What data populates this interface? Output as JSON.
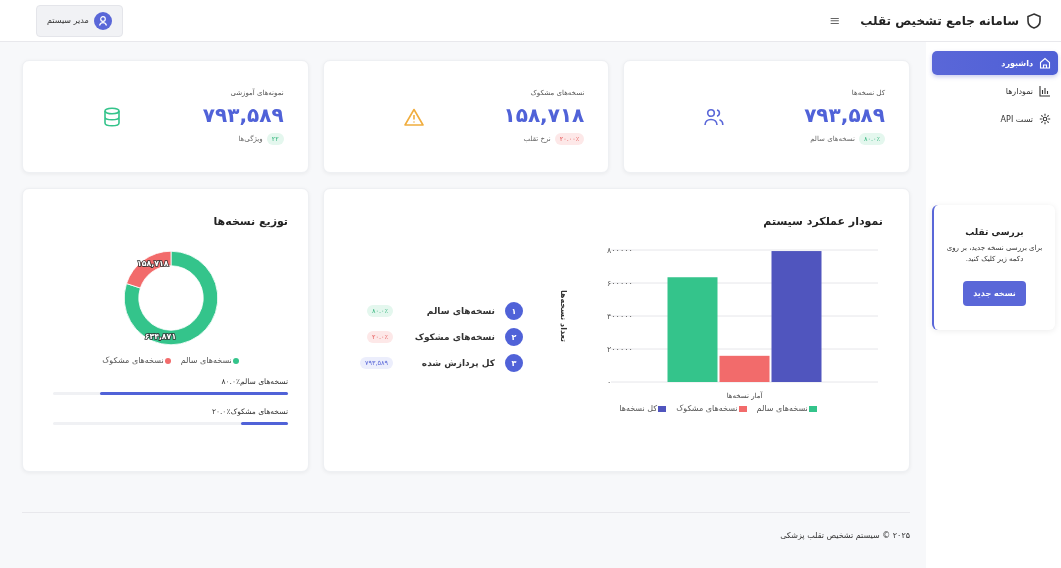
{
  "header": {
    "title": "سامانه جامع تشخیص تقلب",
    "menu_icon": "≡",
    "user": "مدیر سیستم"
  },
  "sidebar": {
    "items": [
      {
        "label": "داشبورد",
        "selected": true
      },
      {
        "label": "نمودارها",
        "selected": false
      },
      {
        "label": "تست API",
        "selected": false
      }
    ],
    "card": {
      "title": "بررسی تقلب",
      "text": "برای بررسی نسخه جدید، بر روی دکمه زیر کلیک کنید.",
      "button": "نسخه جدید"
    }
  },
  "stats": [
    {
      "kind": "users",
      "label": "کل نسخه‌ها",
      "value": "۷۹۳,۵۸۹",
      "badge": "۸۰.۰٪",
      "note": "نسخه‌های سالم"
    },
    {
      "kind": "warning",
      "label": "نسخه‌های مشکوک",
      "value": "۱۵۸,۷۱۸",
      "badge": "۲۰.۰۰٪",
      "note": "نرخ تقلب"
    },
    {
      "kind": "database",
      "label": "نمونه‌های آموزشی",
      "value": "۷۹۳,۵۸۹",
      "badge": "۲۲",
      "note": "ویژگی‌ها"
    }
  ],
  "performance": {
    "title": "نمودار عملکرد سیستم",
    "chart_data": {
      "type": "bar",
      "grid": true,
      "ylabel": "تعداد نسخه‌ها",
      "categories": [
        "آمار نسخه‌ها"
      ],
      "ylim": [
        0,
        800000
      ],
      "yticks": [
        {
          "value": 0,
          "label": "۰"
        },
        {
          "value": 200000,
          "label": "۲۰۰۰۰۰"
        },
        {
          "value": 400000,
          "label": "۴۰۰۰۰۰"
        },
        {
          "value": 600000,
          "label": "۶۰۰۰۰۰"
        },
        {
          "value": 800000,
          "label": "۸۰۰۰۰۰"
        }
      ],
      "series": [
        {
          "name": "نسخه‌های سالم",
          "color": "#34c48b",
          "values": [
            634871
          ]
        },
        {
          "name": "نسخه‌های مشکوک",
          "color": "#f26b6b",
          "values": [
            158718
          ]
        },
        {
          "name": "کل نسخه‌ها",
          "color": "#5055be",
          "values": [
            793589
          ]
        }
      ]
    },
    "items": [
      {
        "kind": "healthy",
        "number": "۱",
        "label": "نسخه‌های سالم",
        "badge": "۸۰.۰٪"
      },
      {
        "kind": "suspicious",
        "number": "۲",
        "label": "نسخه‌های مشکوک",
        "badge": "۲۰.۰٪"
      },
      {
        "kind": "total",
        "number": "۳",
        "label": "کل پردازش شده",
        "badge": "۷۹۳,۵۸۹"
      }
    ]
  },
  "distribution": {
    "title": "توزیع نسخه‌ها",
    "chart_data": {
      "type": "donut",
      "categories": [
        "نسخه‌های سالم",
        "نسخه‌های مشکوک"
      ],
      "values": [
        634871,
        158718
      ],
      "colors": [
        "#34c48b",
        "#f26b6b"
      ],
      "value_labels": [
        "۶۳۴,۸۷۱",
        "۱۵۸,۷۱۸"
      ]
    },
    "progress": [
      {
        "label": "نسخه‌های سالم",
        "percent": "۸۰.۰٪",
        "level": 0.8
      },
      {
        "label": "نسخه‌های مشکوک",
        "percent": "۲۰.۰٪",
        "level": 0.2
      }
    ]
  },
  "footer": "۲۰۲۵ © سیستم تشخیص تقلب پزشکی"
}
